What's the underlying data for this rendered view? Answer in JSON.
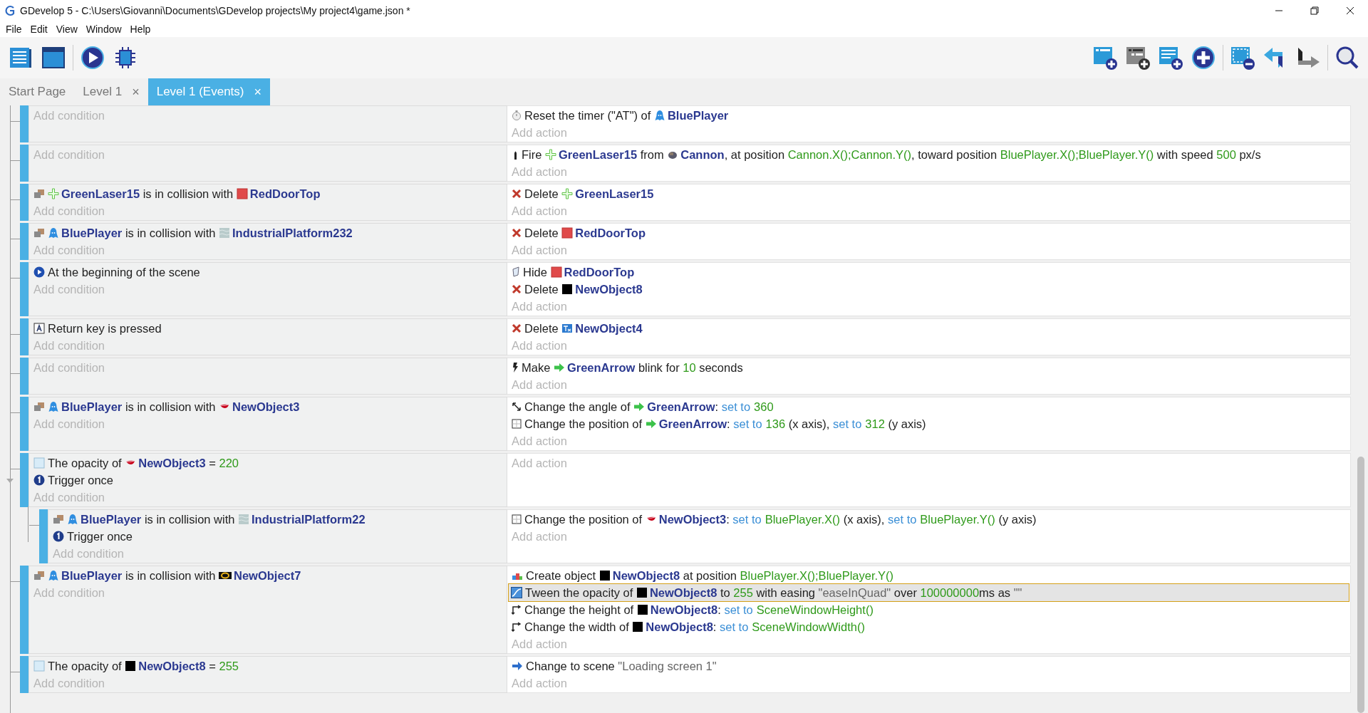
{
  "window": {
    "title": "GDevelop 5 - C:\\Users\\Giovanni\\Documents\\GDevelop projects\\My project4\\game.json *"
  },
  "menu": [
    "File",
    "Edit",
    "View",
    "Window",
    "Help"
  ],
  "tabs": [
    {
      "label": "Start Page",
      "selected": false
    },
    {
      "label": "Level 1",
      "close": "×",
      "selected": false
    },
    {
      "label": "Level 1 (Events)",
      "close": "×",
      "selected": true
    }
  ],
  "events": [
    {
      "add_condition": "Add condition",
      "actions": [
        {
          "kind": "timer",
          "selected": false,
          "parts": [
            {
              "kind": "text",
              "text": "Reset the timer (\"AT\") of "
            },
            {
              "kind": "player",
              "text": "BluePlayer"
            }
          ]
        }
      ],
      "add_action": "Add action"
    },
    {
      "add_condition": "Add condition",
      "actions": [
        {
          "kind": "fire",
          "selected": false,
          "parts": [
            {
              "kind": "text",
              "text": "Fire "
            },
            {
              "kind": "laser",
              "text": "GreenLaser15"
            },
            {
              "kind": "text",
              "text": " from "
            },
            {
              "kind": "cannon",
              "text": "Cannon"
            },
            {
              "kind": "text",
              "text": ", at position "
            },
            {
              "kind": "value",
              "text": "Cannon.X();Cannon.Y()"
            },
            {
              "kind": "text",
              "text": ", toward position "
            },
            {
              "kind": "value",
              "text": "BluePlayer.X();BluePlayer.Y()"
            },
            {
              "kind": "text",
              "text": " with speed "
            },
            {
              "kind": "value",
              "text": "500"
            },
            {
              "kind": "text",
              "text": " px/s"
            }
          ]
        }
      ],
      "add_action": "Add action"
    },
    {
      "conditions": [
        {
          "kind": "collision",
          "selected": false,
          "parts": [
            {
              "kind": "laser",
              "text": "GreenLaser15"
            },
            {
              "kind": "text",
              "text": " is in collision with "
            },
            {
              "kind": "door",
              "text": "RedDoorTop"
            }
          ]
        }
      ],
      "add_condition": "Add condition",
      "actions": [
        {
          "kind": "delete",
          "selected": false,
          "parts": [
            {
              "kind": "text",
              "text": "Delete "
            },
            {
              "kind": "laser",
              "text": "GreenLaser15"
            }
          ]
        }
      ],
      "add_action": "Add action"
    },
    {
      "conditions": [
        {
          "kind": "collision",
          "selected": false,
          "parts": [
            {
              "kind": "player",
              "text": "BluePlayer"
            },
            {
              "kind": "text",
              "text": " is in collision with "
            },
            {
              "kind": "platform",
              "text": "IndustrialPlatform232"
            }
          ]
        }
      ],
      "add_condition": "Add condition",
      "actions": [
        {
          "kind": "delete",
          "selected": false,
          "parts": [
            {
              "kind": "text",
              "text": "Delete "
            },
            {
              "kind": "door",
              "text": "RedDoorTop"
            }
          ]
        }
      ],
      "add_action": "Add action"
    },
    {
      "conditions": [
        {
          "kind": "scene-start",
          "selected": false,
          "parts": [
            {
              "kind": "text",
              "text": "At the beginning of the scene"
            }
          ]
        }
      ],
      "add_condition": "Add condition",
      "actions": [
        {
          "kind": "hide",
          "selected": false,
          "parts": [
            {
              "kind": "text",
              "text": "Hide "
            },
            {
              "kind": "door",
              "text": "RedDoorTop"
            }
          ]
        },
        {
          "kind": "delete",
          "selected": false,
          "parts": [
            {
              "kind": "text",
              "text": "Delete "
            },
            {
              "kind": "black",
              "text": "NewObject8"
            }
          ]
        }
      ],
      "add_action": "Add action"
    },
    {
      "conditions": [
        {
          "kind": "key",
          "selected": false,
          "parts": [
            {
              "kind": "text",
              "text": "Return key is pressed"
            }
          ]
        }
      ],
      "add_condition": "Add condition",
      "actions": [
        {
          "kind": "delete",
          "selected": false,
          "parts": [
            {
              "kind": "text",
              "text": "Delete "
            },
            {
              "kind": "textobj",
              "text": "NewObject4"
            }
          ]
        }
      ],
      "add_action": "Add action"
    },
    {
      "add_condition": "Add condition",
      "actions": [
        {
          "kind": "blink",
          "selected": false,
          "parts": [
            {
              "kind": "text",
              "text": "Make "
            },
            {
              "kind": "arrow",
              "text": "GreenArrow"
            },
            {
              "kind": "text",
              "text": " blink for "
            },
            {
              "kind": "value",
              "text": "10"
            },
            {
              "kind": "text",
              "text": " seconds"
            }
          ]
        }
      ],
      "add_action": "Add action"
    },
    {
      "conditions": [
        {
          "kind": "collision",
          "selected": false,
          "parts": [
            {
              "kind": "player",
              "text": "BluePlayer"
            },
            {
              "kind": "text",
              "text": " is in collision with "
            },
            {
              "kind": "lips",
              "text": "NewObject3"
            }
          ]
        }
      ],
      "add_condition": "Add condition",
      "actions": [
        {
          "kind": "angle",
          "selected": false,
          "parts": [
            {
              "kind": "text",
              "text": "Change the angle of "
            },
            {
              "kind": "arrow",
              "text": "GreenArrow"
            },
            {
              "kind": "text",
              "text": ": "
            },
            {
              "kind": "operator",
              "text": "set to"
            },
            {
              "kind": "value",
              "text": "360"
            }
          ]
        },
        {
          "kind": "position",
          "selected": false,
          "parts": [
            {
              "kind": "text",
              "text": "Change the position of "
            },
            {
              "kind": "arrow",
              "text": "GreenArrow"
            },
            {
              "kind": "text",
              "text": ": "
            },
            {
              "kind": "operator",
              "text": "set to"
            },
            {
              "kind": "value",
              "text": "136"
            },
            {
              "kind": "text",
              "text": " (x axis), "
            },
            {
              "kind": "operator",
              "text": "set to"
            },
            {
              "kind": "value",
              "text": "312"
            },
            {
              "kind": "text",
              "text": " (y axis)"
            }
          ]
        }
      ],
      "add_action": "Add action"
    },
    {
      "conditions": [
        {
          "kind": "opacity",
          "selected": false,
          "parts": [
            {
              "kind": "text",
              "text": "The opacity of "
            },
            {
              "kind": "lips",
              "text": "NewObject3"
            },
            {
              "kind": "text",
              "text": " = "
            },
            {
              "kind": "value",
              "text": "220"
            }
          ]
        },
        {
          "kind": "trigger",
          "selected": false,
          "parts": [
            {
              "kind": "text",
              "text": "Trigger once"
            }
          ]
        }
      ],
      "add_condition": "Add condition",
      "add_action": "Add action",
      "children": [
        {
          "conditions": [
            {
              "kind": "collision",
              "selected": false,
              "parts": [
                {
                  "kind": "player",
                  "text": "BluePlayer"
                },
                {
                  "kind": "text",
                  "text": " is in collision with "
                },
                {
                  "kind": "platform",
                  "text": "IndustrialPlatform22"
                }
              ]
            },
            {
              "kind": "trigger",
              "selected": false,
              "parts": [
                {
                  "kind": "text",
                  "text": "Trigger once"
                }
              ]
            }
          ],
          "add_condition": "Add condition",
          "actions": [
            {
              "kind": "position",
              "selected": false,
              "parts": [
                {
                  "kind": "text",
                  "text": "Change the position of "
                },
                {
                  "kind": "lips",
                  "text": "NewObject3"
                },
                {
                  "kind": "text",
                  "text": ": "
                },
                {
                  "kind": "operator",
                  "text": "set to"
                },
                {
                  "kind": "value",
                  "text": "BluePlayer.X()"
                },
                {
                  "kind": "text",
                  "text": " (x axis), "
                },
                {
                  "kind": "operator",
                  "text": "set to"
                },
                {
                  "kind": "value",
                  "text": "BluePlayer.Y()"
                },
                {
                  "kind": "text",
                  "text": " (y axis)"
                }
              ]
            }
          ],
          "add_action": "Add action"
        }
      ]
    },
    {
      "conditions": [
        {
          "kind": "collision",
          "selected": false,
          "parts": [
            {
              "kind": "player",
              "text": "BluePlayer"
            },
            {
              "kind": "text",
              "text": " is in collision with "
            },
            {
              "kind": "ring",
              "text": "NewObject7"
            }
          ]
        }
      ],
      "add_condition": "Add condition",
      "actions": [
        {
          "kind": "create",
          "selected": false,
          "parts": [
            {
              "kind": "text",
              "text": "Create object "
            },
            {
              "kind": "black",
              "text": "NewObject8"
            },
            {
              "kind": "text",
              "text": " at position "
            },
            {
              "kind": "value",
              "text": "BluePlayer.X();BluePlayer.Y()"
            }
          ]
        },
        {
          "kind": "tween",
          "selected": true,
          "parts": [
            {
              "kind": "text",
              "text": "Tween the opacity of "
            },
            {
              "kind": "black",
              "text": "NewObject8"
            },
            {
              "kind": "text",
              "text": " to "
            },
            {
              "kind": "value",
              "text": "255"
            },
            {
              "kind": "text",
              "text": " with easing "
            },
            {
              "kind": "string",
              "text": "\"easeInQuad\""
            },
            {
              "kind": "text",
              "text": " over "
            },
            {
              "kind": "value",
              "text": "100000000"
            },
            {
              "kind": "text",
              "text": "ms as "
            },
            {
              "kind": "string",
              "text": "\"\""
            }
          ]
        },
        {
          "kind": "size",
          "selected": false,
          "parts": [
            {
              "kind": "text",
              "text": "Change the height of "
            },
            {
              "kind": "black",
              "text": "NewObject8"
            },
            {
              "kind": "text",
              "text": ": "
            },
            {
              "kind": "operator",
              "text": "set to"
            },
            {
              "kind": "value",
              "text": "SceneWindowHeight()"
            }
          ]
        },
        {
          "kind": "size",
          "selected": false,
          "parts": [
            {
              "kind": "text",
              "text": "Change the width of "
            },
            {
              "kind": "black",
              "text": "NewObject8"
            },
            {
              "kind": "text",
              "text": ": "
            },
            {
              "kind": "operator",
              "text": "set to"
            },
            {
              "kind": "value",
              "text": "SceneWindowWidth()"
            }
          ]
        }
      ],
      "add_action": "Add action"
    },
    {
      "conditions": [
        {
          "kind": "opacity",
          "selected": false,
          "parts": [
            {
              "kind": "text",
              "text": "The opacity of "
            },
            {
              "kind": "black",
              "text": "NewObject8"
            },
            {
              "kind": "text",
              "text": " = "
            },
            {
              "kind": "value",
              "text": "255"
            }
          ]
        }
      ],
      "add_condition": "Add condition",
      "actions": [
        {
          "kind": "scene-change",
          "selected": false,
          "parts": [
            {
              "kind": "text",
              "text": "Change to scene "
            },
            {
              "kind": "string",
              "text": "\"Loading screen 1\""
            }
          ]
        }
      ],
      "add_action": "Add action"
    }
  ]
}
